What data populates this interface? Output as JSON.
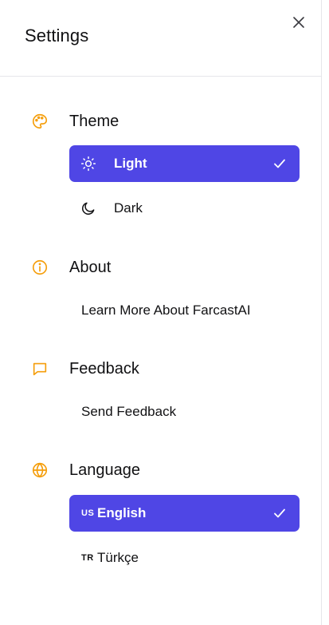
{
  "header": {
    "title": "Settings",
    "close_icon": "close-icon"
  },
  "colors": {
    "accent": "#4f46e5",
    "section_icon": "#f59e0b",
    "text": "#111113",
    "divider": "#e5e5ea"
  },
  "sections": {
    "theme": {
      "label": "Theme",
      "icon": "palette-icon",
      "options": [
        {
          "label": "Light",
          "icon": "sun-icon",
          "selected": true
        },
        {
          "label": "Dark",
          "icon": "moon-icon",
          "selected": false
        }
      ]
    },
    "about": {
      "label": "About",
      "icon": "info-icon",
      "link": "Learn More About FarcastAI"
    },
    "feedback": {
      "label": "Feedback",
      "icon": "message-icon",
      "link": "Send Feedback"
    },
    "language": {
      "label": "Language",
      "icon": "globe-icon",
      "options": [
        {
          "code": "US",
          "label": "English",
          "selected": true
        },
        {
          "code": "TR",
          "label": "Türkçe",
          "selected": false
        }
      ]
    }
  }
}
